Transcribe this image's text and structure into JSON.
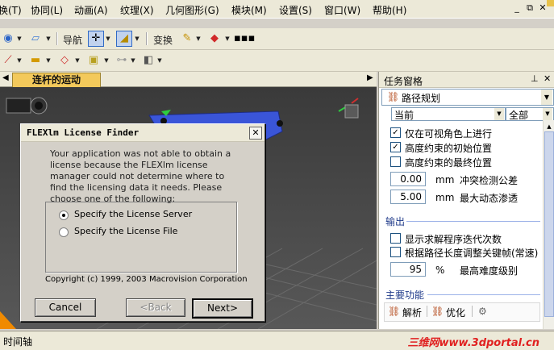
{
  "menu": {
    "items": [
      "换(T)",
      "协同(L)",
      "动画(A)",
      "纹理(X)",
      "几何图形(G)",
      "模块(M)",
      "设置(S)",
      "窗口(W)",
      "帮助(H)"
    ]
  },
  "toolbar1": {
    "nav_label": "导航",
    "transform_label": "变换"
  },
  "document": {
    "tab_label": "连杆的运动"
  },
  "taskpane": {
    "title": "任务窗格",
    "task_select": "路径规划",
    "filter_left": "当前",
    "filter_right": "全部",
    "options": [
      {
        "label": "仅在可视角色上进行",
        "checked": true
      },
      {
        "label": "高度约束的初始位置",
        "checked": true
      },
      {
        "label": "高度约束的最终位置",
        "checked": false
      }
    ],
    "collision": {
      "value": "0.00",
      "unit": "mm",
      "label": "冲突检测公差"
    },
    "penetration": {
      "value": "5.00",
      "unit": "mm",
      "label": "最大动态渗透"
    },
    "output_title": "输出",
    "output_options": [
      {
        "label": "显示求解程序迭代次数",
        "checked": false
      },
      {
        "label": "根据路径长度调整关键帧(常速)",
        "checked": false
      }
    ],
    "difficulty": {
      "value": "95",
      "unit": "%",
      "label": "最高难度级别"
    },
    "main_title": "主要功能",
    "actions": {
      "solve": "解析",
      "optimize": "优化"
    }
  },
  "dialog": {
    "title": "FLEXlm License Finder",
    "message": "Your application was not able to obtain a license because the FLEXlm license manager could not determine where to find the licensing data it needs.  Please choose one of the following:",
    "option_server": "Specify the License Server",
    "option_file": "Specify the License File",
    "selected": "server",
    "copyright": "Copyright (c) 1999, 2003 Macrovision Corporation",
    "cancel": "Cancel",
    "back": "<Back",
    "next": "Next>"
  },
  "bottom": {
    "timeline_label": "时间轴",
    "watermark": "三维网www.3dportal.cn"
  },
  "colors": {
    "tab_accent": "#f3c95b",
    "viewport_bg": "#474747",
    "model_blue": "#3a55d8",
    "watermark": "#e02020"
  }
}
